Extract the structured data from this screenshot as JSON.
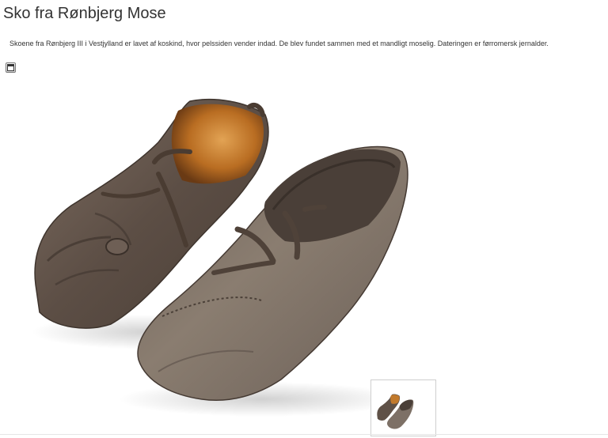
{
  "page": {
    "title": "Sko fra Rønbjerg Mose",
    "description": "Skoene fra Rønbjerg III i Vestjylland er lavet af koskind, hvor pelssiden vender indad. De blev fundet sammen med et mandligt moselig. Dateringen er førromersk jernalder."
  },
  "icons": {
    "fullscreen": "fullscreen-toggle-icon",
    "thumbnail": "image-thumbnail"
  },
  "colors": {
    "background": "#ffffff",
    "text": "#333333",
    "leather_dark": "#5a4b40",
    "leather_light": "#8a7a6c",
    "fur_lining": "#c07a2e"
  }
}
